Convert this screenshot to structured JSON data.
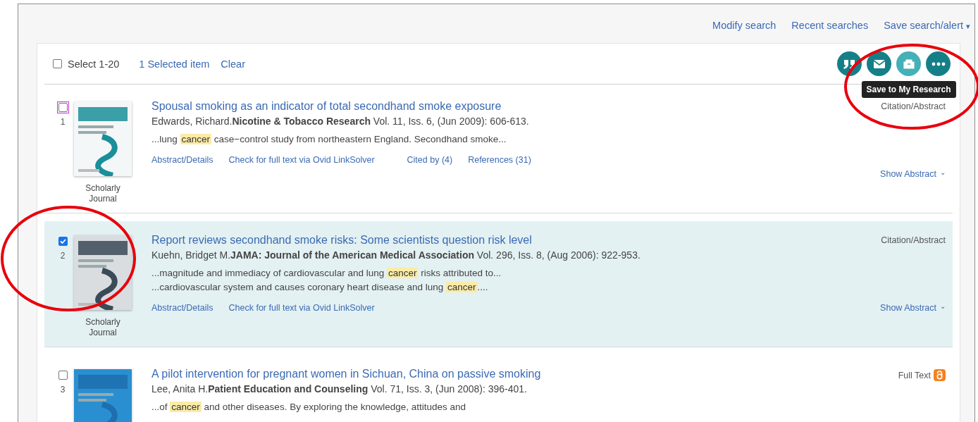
{
  "top_links": [
    {
      "label": "Modify search"
    },
    {
      "label": "Recent searches"
    },
    {
      "label": "Save search/alert",
      "caret": "▾"
    }
  ],
  "toolbar": {
    "select_label": "Select 1-20",
    "select_all_checked": false,
    "selected_count": "1 Selected item",
    "clear": "Clear",
    "circled": true,
    "actions": [
      {
        "kind": "cite",
        "hovered": false
      },
      {
        "kind": "email",
        "hovered": false
      },
      {
        "kind": "save",
        "hovered": true,
        "tooltip": "Save to My Research"
      },
      {
        "kind": "more",
        "hovered": false
      }
    ]
  },
  "results": [
    {
      "number": "1",
      "checked": false,
      "focused": true,
      "circled": false,
      "doc_type": "Scholarly Journal",
      "title": "Spousal smoking as an indicator of total secondhand smoke exposure",
      "citation": "Edwards, Richard.**Nicotine & Tobacco Research** Vol. 11, Iss. 6,  (Jun 2009): 606-613.",
      "snippets": [
        [
          {
            "text": "...lung ",
            "highlighted": false
          },
          {
            "text": "cancer",
            "highlighted": true
          },
          {
            "text": " case−control study from northeastern England. Secondhand smoke...",
            "highlighted": false
          }
        ]
      ],
      "links": [
        "Abstract/Details",
        "Check for full text via Ovid LinkSolver",
        "Cited by (4)",
        "References (31)"
      ],
      "format": "Citation/Abstract",
      "open_access": false,
      "show_abstract": {
        "label": "Show Abstract",
        "icon": "⌄"
      }
    },
    {
      "number": "2",
      "checked": true,
      "focused": false,
      "circled": true,
      "doc_type": "Scholarly Journal",
      "title": "Report reviews secondhand smoke risks: Some scientists question risk level",
      "citation": "Kuehn, Bridget M.**JAMA: Journal of the American Medical Association** Vol. 296, Iss. 8,  (Aug 2006): 922-953.",
      "snippets": [
        [
          {
            "text": "...magnitude and immediacy of cardiovascular and lung ",
            "highlighted": false
          },
          {
            "text": "cancer",
            "highlighted": true
          },
          {
            "text": " risks attributed to...",
            "highlighted": false
          }
        ],
        [
          {
            "text": "...cardiovascular system and causes coronary heart disease and lung ",
            "highlighted": false
          },
          {
            "text": "cancer",
            "highlighted": true
          },
          {
            "text": "....",
            "highlighted": false
          }
        ]
      ],
      "links": [
        "Abstract/Details",
        "Check for full text via Ovid LinkSolver"
      ],
      "format": "Citation/Abstract",
      "open_access": false,
      "show_abstract": {
        "label": "Show Abstract",
        "icon": "⌄"
      }
    },
    {
      "number": "3",
      "checked": false,
      "focused": false,
      "circled": false,
      "title": "A pilot intervention for pregnant women in Sichuan, China on passive smoking",
      "citation": "Lee, Anita H.**Patient Education and Counseling** Vol. 71, Iss. 3,  (Jun 2008): 396-401.",
      "snippets": [
        [
          {
            "text": "...of ",
            "highlighted": false
          },
          {
            "text": "cancer",
            "highlighted": true
          },
          {
            "text": " and other diseases. By exploring the knowledge, attitudes and",
            "highlighted": false
          }
        ]
      ],
      "format": "Full Text",
      "open_access": true
    }
  ]
}
